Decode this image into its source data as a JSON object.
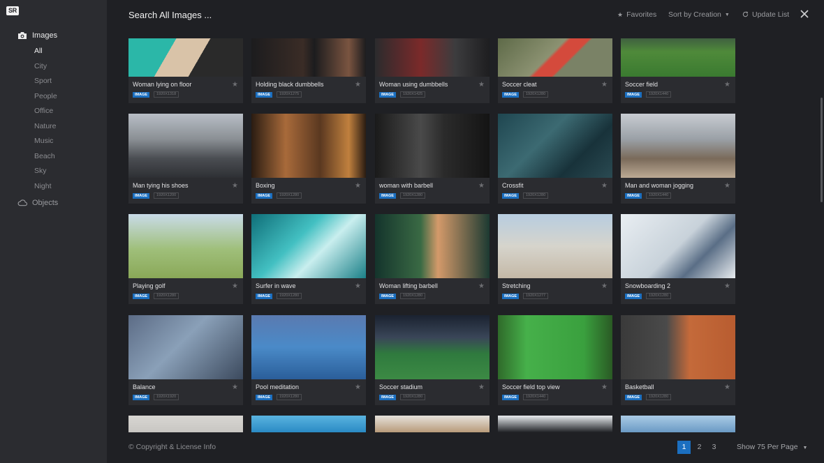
{
  "logo": "SR",
  "sidebar": {
    "images_label": "Images",
    "objects_label": "Objects",
    "categories": [
      "All",
      "City",
      "Sport",
      "People",
      "Office",
      "Nature",
      "Music",
      "Beach",
      "Sky",
      "Night"
    ]
  },
  "header": {
    "search_placeholder": "Search All Images ...",
    "favorites": "Favorites",
    "sort": "Sort by Creation",
    "update": "Update List"
  },
  "images": [
    {
      "title": "Woman lying on floor",
      "type": "IMAGE",
      "res": "1920X1318"
    },
    {
      "title": "Holding black dumbbells",
      "type": "IMAGE",
      "res": "1920X1275"
    },
    {
      "title": "Woman using dumbbells",
      "type": "IMAGE",
      "res": "1920X1425"
    },
    {
      "title": "Soccer cleat",
      "type": "IMAGE",
      "res": "1920X1280"
    },
    {
      "title": "Soccer field",
      "type": "IMAGE",
      "res": "1920X1440"
    },
    {
      "title": "Man tying his shoes",
      "type": "IMAGE",
      "res": "1920X1200"
    },
    {
      "title": "Boxing",
      "type": "IMAGE",
      "res": "1920X1280"
    },
    {
      "title": "woman with barbell",
      "type": "IMAGE",
      "res": "1920X1280"
    },
    {
      "title": "Crossfit",
      "type": "IMAGE",
      "res": "1920X1280"
    },
    {
      "title": "Man and woman jogging",
      "type": "IMAGE",
      "res": "1920X1440"
    },
    {
      "title": "Playing golf",
      "type": "IMAGE",
      "res": "1920X1280"
    },
    {
      "title": "Surfer in wave",
      "type": "IMAGE",
      "res": "1920X1280"
    },
    {
      "title": "Woman lifting barbell",
      "type": "IMAGE",
      "res": "1920X1280"
    },
    {
      "title": "Stretching",
      "type": "IMAGE",
      "res": "1920X1277"
    },
    {
      "title": "Snowboarding 2",
      "type": "IMAGE",
      "res": "1920X1280"
    },
    {
      "title": "Balance",
      "type": "IMAGE",
      "res": "1920X1920"
    },
    {
      "title": "Pool meditation",
      "type": "IMAGE",
      "res": "1920X1280"
    },
    {
      "title": "Soccer stadium",
      "type": "IMAGE",
      "res": "1920X1280"
    },
    {
      "title": "Soccer field top view",
      "type": "IMAGE",
      "res": "1920X1440"
    },
    {
      "title": "Basketball",
      "type": "IMAGE",
      "res": "1920X1280"
    },
    {
      "title": "",
      "type": "",
      "res": ""
    },
    {
      "title": "",
      "type": "",
      "res": ""
    },
    {
      "title": "",
      "type": "",
      "res": ""
    },
    {
      "title": "",
      "type": "",
      "res": ""
    },
    {
      "title": "",
      "type": "",
      "res": ""
    }
  ],
  "footer": {
    "copyright": "© Copyright & License Info",
    "pages": [
      "1",
      "2",
      "3"
    ],
    "current_page": "1",
    "per_page": "Show 75 Per Page"
  },
  "colors": {
    "accent": "#1b6fc0",
    "sidebar_bg": "#2b2c30",
    "main_bg": "#1f2024"
  }
}
